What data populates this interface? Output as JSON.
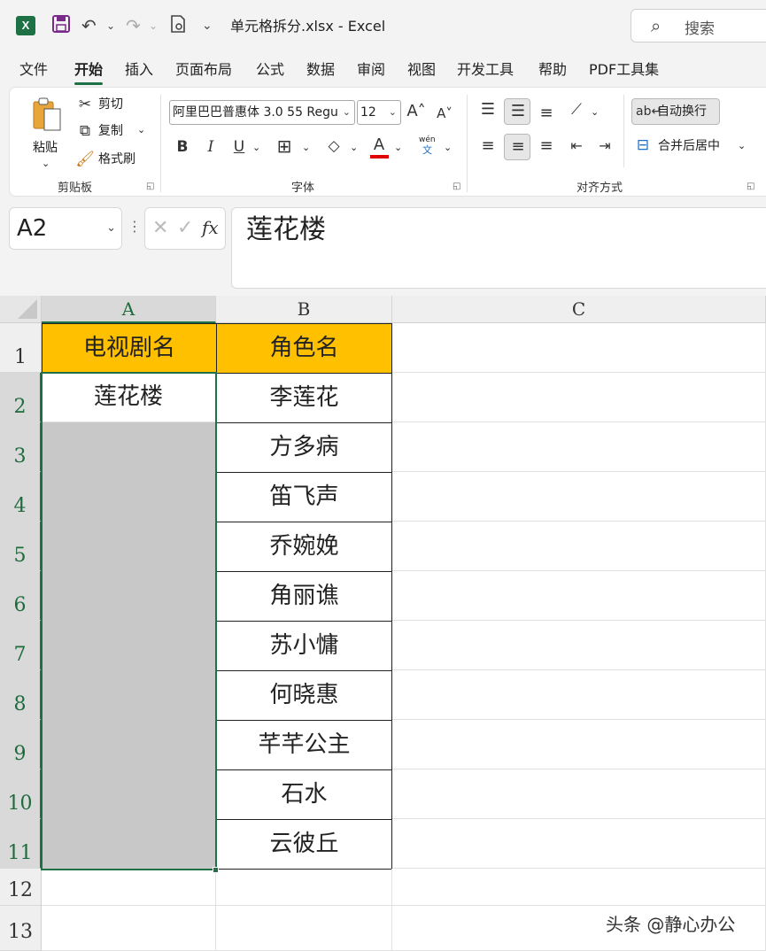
{
  "titlebar": {
    "app_icon": "X",
    "doc_title": "单元格拆分.xlsx  -  Excel",
    "search_label": "搜索"
  },
  "menu": [
    "文件",
    "开始",
    "插入",
    "页面布局",
    "公式",
    "数据",
    "审阅",
    "视图",
    "开发工具",
    "帮助",
    "PDF工具集"
  ],
  "ribbon": {
    "clipboard": {
      "paste": "粘贴",
      "cut": "剪切",
      "copy": "复制",
      "format_painter": "格式刷",
      "group": "剪贴板"
    },
    "font": {
      "font_name": "阿里巴巴普惠体 3.0 55 Regu",
      "font_size": "12",
      "bold": "B",
      "italic": "I",
      "underline": "U",
      "font_color_letter": "A",
      "phonetic_top": "wén",
      "phonetic_bottom": "文",
      "group": "字体"
    },
    "alignment": {
      "wrap_text": "自动换行",
      "merge_center": "合并后居中",
      "group": "对齐方式"
    }
  },
  "formula_bar": {
    "name_box": "A2",
    "fx": "fx",
    "content": "莲花楼"
  },
  "grid": {
    "columns": [
      "A",
      "B",
      "C"
    ],
    "rows": [
      "1",
      "2",
      "3",
      "4",
      "5",
      "6",
      "7",
      "8",
      "9",
      "10",
      "11",
      "12",
      "13"
    ],
    "header_a": "电视剧名",
    "header_b": "角色名",
    "a2": "莲花楼",
    "roles": [
      "李莲花",
      "方多病",
      "笛飞声",
      "乔婉娩",
      "角丽谯",
      "苏小慵",
      "何晓惠",
      "芊芊公主",
      "石水",
      "云彼丘"
    ]
  },
  "colors": {
    "header_fill": "#ffc000",
    "selection_fill": "#c8c8c8",
    "accent": "#1e7145",
    "font_color_bar": "#e00000"
  },
  "watermark": "头条 @静心办公"
}
